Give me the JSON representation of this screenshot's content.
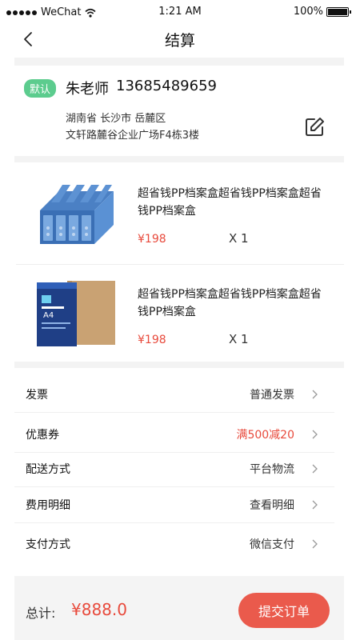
{
  "status_bar": {
    "carrier": "WeChat",
    "time": "1:21 AM",
    "battery": "100%"
  },
  "nav": {
    "title": "结算",
    "back_icon": "chevron-left-icon"
  },
  "address": {
    "badge": "默认",
    "name": "朱老师",
    "phone": "13685489659",
    "region": "湖南省  长沙市  岳麓区",
    "detail": "文轩路麓谷企业广场F4栋3楼",
    "edit_icon": "edit-icon"
  },
  "products": [
    {
      "name": "超省钱PP档案盒超省钱PP档案盒超省钱PP档案盒",
      "price": "¥198",
      "qty": "X 1",
      "image_icon": "file-organizer-image"
    },
    {
      "name": "超省钱PP档案盒超省钱PP档案盒超省钱PP档案盒",
      "price": "¥198",
      "qty": "X 1",
      "image_icon": "a4-paper-box-image"
    }
  ],
  "options": [
    {
      "label": "发票",
      "value": "普通发票"
    },
    {
      "label": "优惠券",
      "value": "满500减20"
    },
    {
      "label": "配送方式",
      "value": "平台物流"
    },
    {
      "label": "费用明细",
      "value": "查看明细"
    },
    {
      "label": "支付方式",
      "value": "微信支付"
    }
  ],
  "footer": {
    "total_label": "总计:",
    "total_amount": "¥888.0",
    "submit": "提交订单"
  },
  "colors": {
    "accent_red": "#ea5a4c",
    "price_red": "#e84a3c",
    "badge_green": "#5ccc8e"
  }
}
